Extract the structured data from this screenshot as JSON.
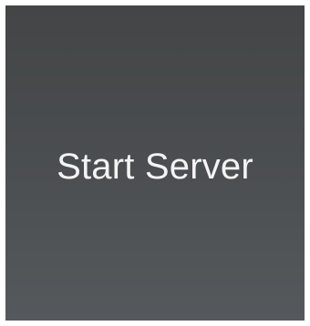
{
  "start_server_button": {
    "label": "Start Server"
  },
  "colors": {
    "background_top": "#434546",
    "background_bottom": "#55595d",
    "text": "#f4f4f4",
    "page": "#ffffff"
  }
}
